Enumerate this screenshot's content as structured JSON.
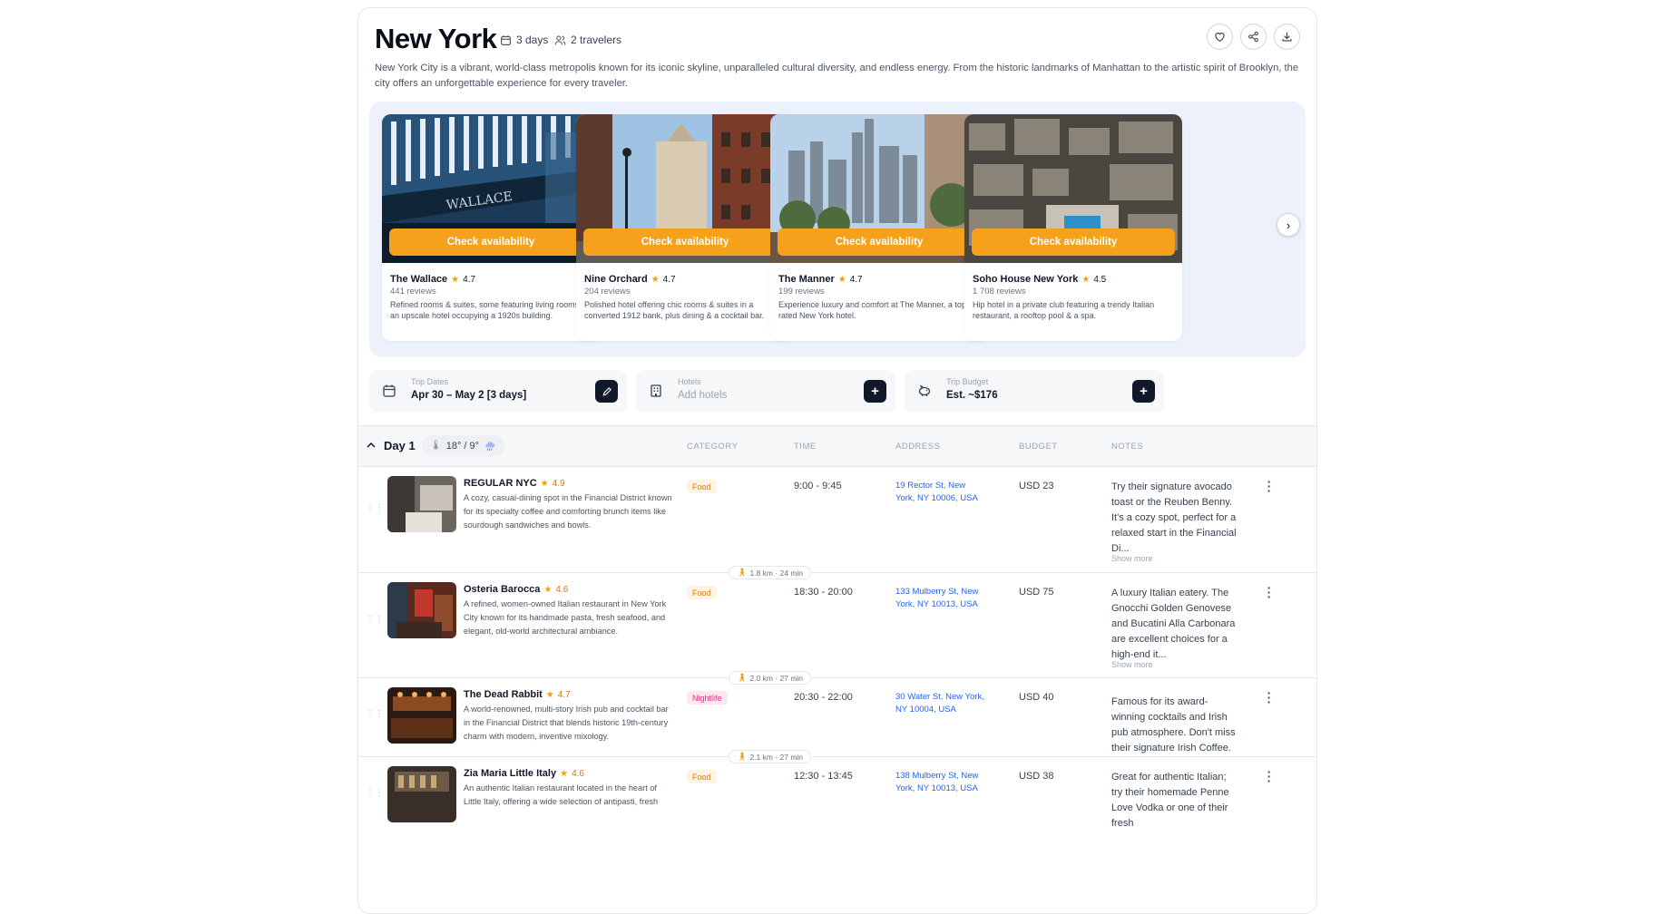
{
  "trip": {
    "title": "New York",
    "days": "3 days",
    "travelers": "2 travelers",
    "description": "New York City is a vibrant, world-class metropolis known for its iconic skyline, unparalleled cultural diversity, and endless energy. From the historic landmarks of Manhattan to the artistic spirit of Brooklyn, the city offers an unforgettable experience for every traveler."
  },
  "hotels": [
    {
      "name": "The Wallace",
      "rating": "4.7",
      "reviews": "441 reviews",
      "desc": "Refined rooms & suites, some featuring living rooms, in an upscale hotel occupying a 1920s building.",
      "cta": "Check availability"
    },
    {
      "name": "Nine Orchard",
      "rating": "4.7",
      "reviews": "204 reviews",
      "desc": "Polished hotel offering chic rooms & suites in a converted 1912 bank, plus dining & a cocktail bar.",
      "cta": "Check availability"
    },
    {
      "name": "The Manner",
      "rating": "4.7",
      "reviews": "199 reviews",
      "desc": "Experience luxury and comfort at The Manner, a top-rated New York hotel.",
      "cta": "Check availability"
    },
    {
      "name": "Soho House New York",
      "rating": "4.5",
      "reviews": "1 708 reviews",
      "desc": "Hip hotel in a private club featuring a trendy Italian restaurant, a rooftop pool & a spa.",
      "cta": "Check availability"
    }
  ],
  "hotel_signage": "WALLACE",
  "info": {
    "dates_label": "Trip Dates",
    "dates_value": "Apr 30 – May 2 [3 days]",
    "hotels_label": "Hotels",
    "hotels_placeholder": "Add hotels",
    "budget_label": "Trip Budget",
    "budget_value": "Est. ~$176"
  },
  "day": {
    "label": "Day 1",
    "weather": "18° / 9°",
    "columns": [
      "CATEGORY",
      "TIME",
      "ADDRESS",
      "BUDGET",
      "NOTES"
    ]
  },
  "activities": [
    {
      "name": "REGULAR NYC",
      "rating": "4.9",
      "desc": "A cozy, casual-dining spot in the Financial District known for its specialty coffee and comforting brunch items like sourdough sandwiches and bowls.",
      "category": "Food",
      "time": "9:00 - 9:45",
      "address": "19 Rector St, New York, NY 10006, USA",
      "budget": "USD 23",
      "notes": "Try their signature avocado toast or the Reuben Benny. It's a cozy spot, perfect for a relaxed start in the Financial Di...",
      "more": "Show more"
    },
    {
      "name": "Osteria Barocca",
      "rating": "4.6",
      "desc": "A refined, women-owned Italian restaurant in New York City known for its handmade pasta, fresh seafood, and elegant, old-world architectural ambiance.",
      "category": "Food",
      "time": "18:30 - 20:00",
      "address": "133 Mulberry St, New York, NY 10013, USA",
      "budget": "USD 75",
      "notes": "A luxury Italian eatery. The Gnocchi Golden Genovese and Bucatini Alla Carbonara are excellent choices for a high-end it...",
      "more": "Show more"
    },
    {
      "name": "The Dead Rabbit",
      "rating": "4.7",
      "desc": "A world-renowned, multi-story Irish pub and cocktail bar in the Financial District that blends historic 19th-century charm with modern, inventive mixology.",
      "category": "Nightlife",
      "time": "20:30 - 22:00",
      "address": "30 Water St, New York, NY 10004, USA",
      "budget": "USD 40",
      "notes": "Famous for its award-winning cocktails and Irish pub atmosphere. Don't miss their signature Irish Coffee.",
      "more": ""
    },
    {
      "name": "Zia Maria Little Italy",
      "rating": "4.6",
      "desc": "An authentic Italian restaurant located in the heart of Little Italy, offering a wide selection of antipasti, fresh",
      "category": "Food",
      "time": "12:30 - 13:45",
      "address": "138 Mulberry St, New York, NY 10013, USA",
      "budget": "USD 38",
      "notes": "Great for authentic Italian; try their homemade Penne Love Vodka or one of their fresh",
      "more": ""
    }
  ],
  "transfers": [
    "1.8 km · 24 min",
    "2.0 km · 27 min",
    "2.1 km · 27 min"
  ],
  "colors": {
    "accent": "#f5a11b",
    "dark": "#111827",
    "link": "#2563eb"
  }
}
